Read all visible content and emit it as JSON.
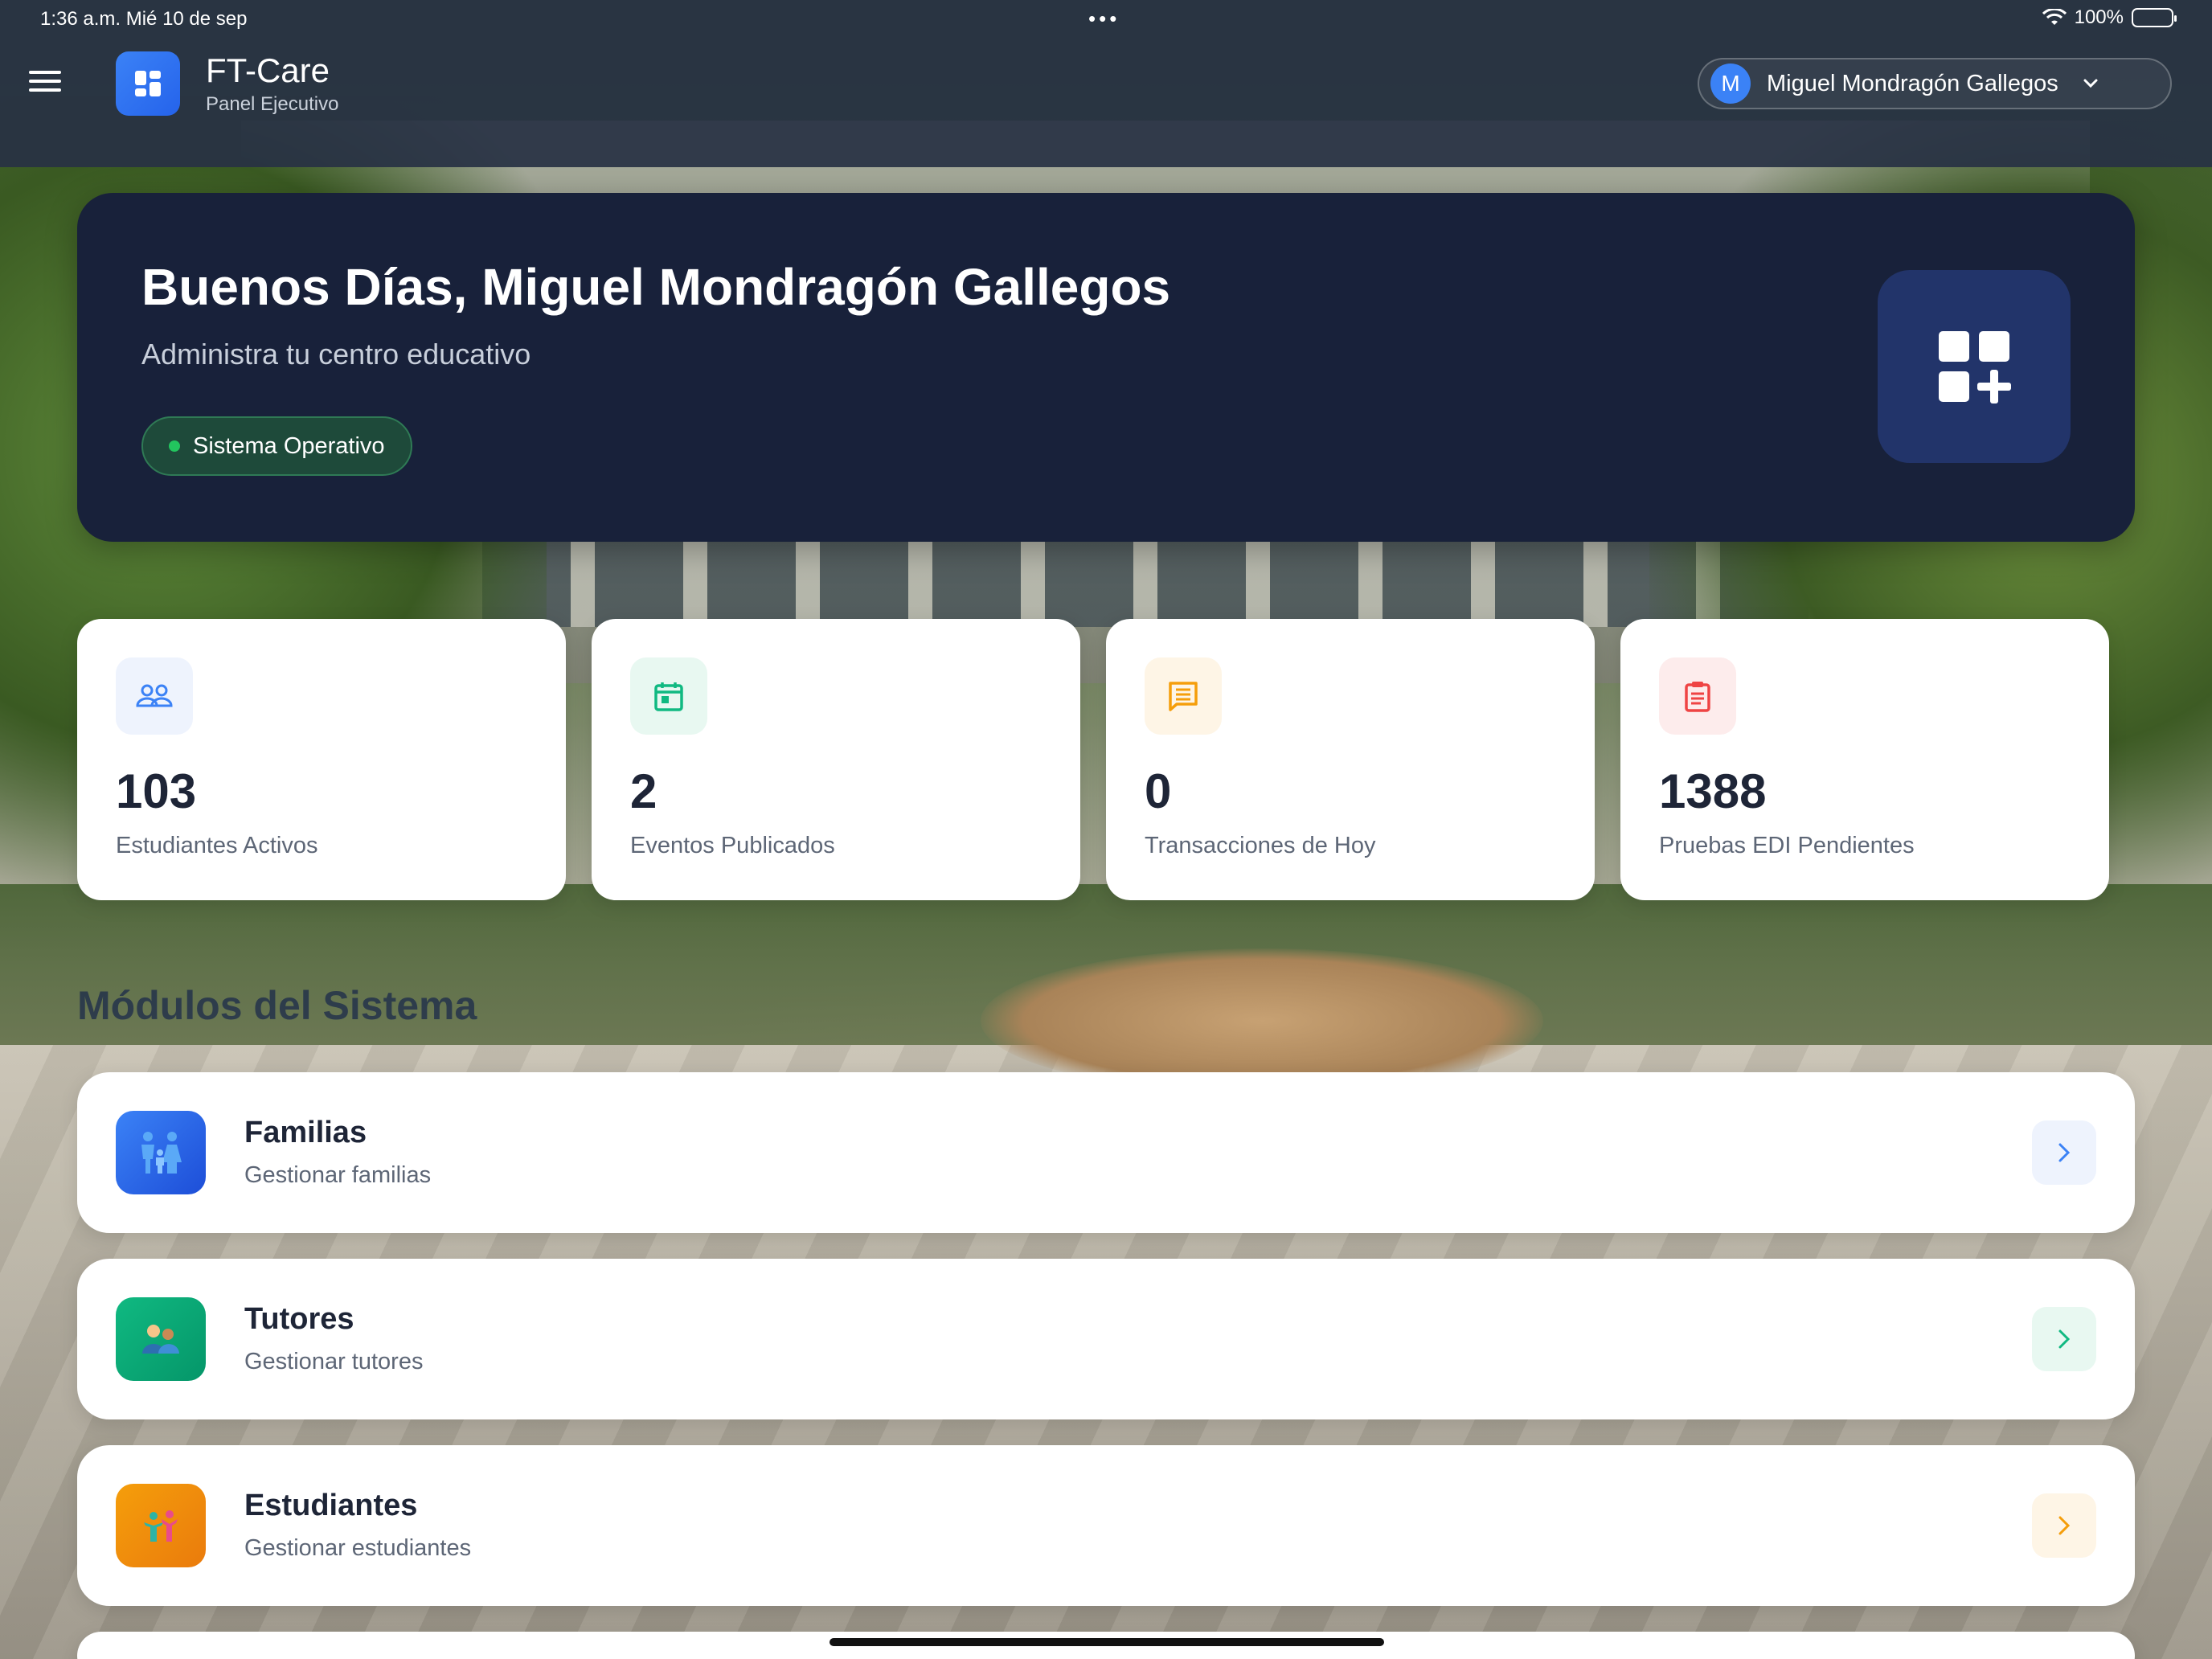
{
  "status_bar": {
    "time": "1:36 a.m.  Mié 10 de sep",
    "dots": "•••",
    "battery": "100%",
    "battery_level": 1.0
  },
  "header": {
    "app_title": "FT-Care",
    "app_subtitle": "Panel Ejecutivo",
    "user_initial": "M",
    "user_name": "Miguel  Mondragón Gallegos"
  },
  "hero": {
    "greeting": "Buenos Días, Miguel  Mondragón Gallegos",
    "subtitle": "Administra tu centro educativo",
    "status": "Sistema Operativo",
    "status_color": "#22c55e"
  },
  "stats": [
    {
      "value": "103",
      "label": "Estudiantes Activos",
      "icon": "users-icon",
      "color": "#3b82f6",
      "bg": "#eef3fd"
    },
    {
      "value": "2",
      "label": "Eventos Publicados",
      "icon": "calendar-icon",
      "color": "#10b981",
      "bg": "#e8f8f1"
    },
    {
      "value": "0",
      "label": "Transacciones de Hoy",
      "icon": "message-icon",
      "color": "#f59e0b",
      "bg": "#fef5e6"
    },
    {
      "value": "1388",
      "label": "Pruebas EDI Pendientes",
      "icon": "clipboard-icon",
      "color": "#ef4444",
      "bg": "#fdecec"
    }
  ],
  "section_title": "Módulos del Sistema",
  "modules": [
    {
      "title": "Familias",
      "subtitle": "Gestionar familias",
      "icon": "family-icon",
      "color": "#3b82f6",
      "go_bg": "#eef3fd"
    },
    {
      "title": "Tutores",
      "subtitle": "Gestionar tutores",
      "icon": "tutors-icon",
      "color": "#10b981",
      "go_bg": "#e8f8f1"
    },
    {
      "title": "Estudiantes",
      "subtitle": "Gestionar estudiantes",
      "icon": "students-icon",
      "color": "#f59e0b",
      "go_bg": "#fef5e6"
    }
  ]
}
